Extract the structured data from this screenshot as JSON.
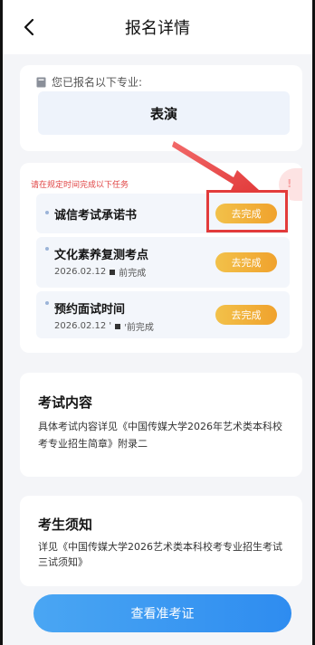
{
  "header": {
    "title": "报名详情"
  },
  "registration": {
    "info": "您已报名以下专业:",
    "major": "表演"
  },
  "tasks": {
    "notice": "请在规定时间完成以下任务",
    "items": [
      {
        "title": "诚信考试承诺书",
        "sub": "",
        "action": "去完成"
      },
      {
        "title": "文化素养复测考点",
        "date": "2026.02.12",
        "suffix": "前完成",
        "action": "去完成"
      },
      {
        "title": "预约面试时间",
        "date": "2026.02.12 '",
        "suffix": "'前完成",
        "action": "去完成"
      }
    ]
  },
  "exam_content": {
    "title": "考试内容",
    "body": "具体考试内容详见《中国传媒大学2026年艺术类本科校考专业招生简章》附录二"
  },
  "candidate_notice": {
    "title": "考生须知",
    "body": "详见《中国传媒大学2026艺术类本科校考专业招生考试三试须知》"
  },
  "footer": {
    "button_label": "查看准考证"
  },
  "colors": {
    "accent_blue": "#2e8cf0",
    "action_orange": "#f0a22d",
    "highlight_red": "#e23b3b"
  }
}
